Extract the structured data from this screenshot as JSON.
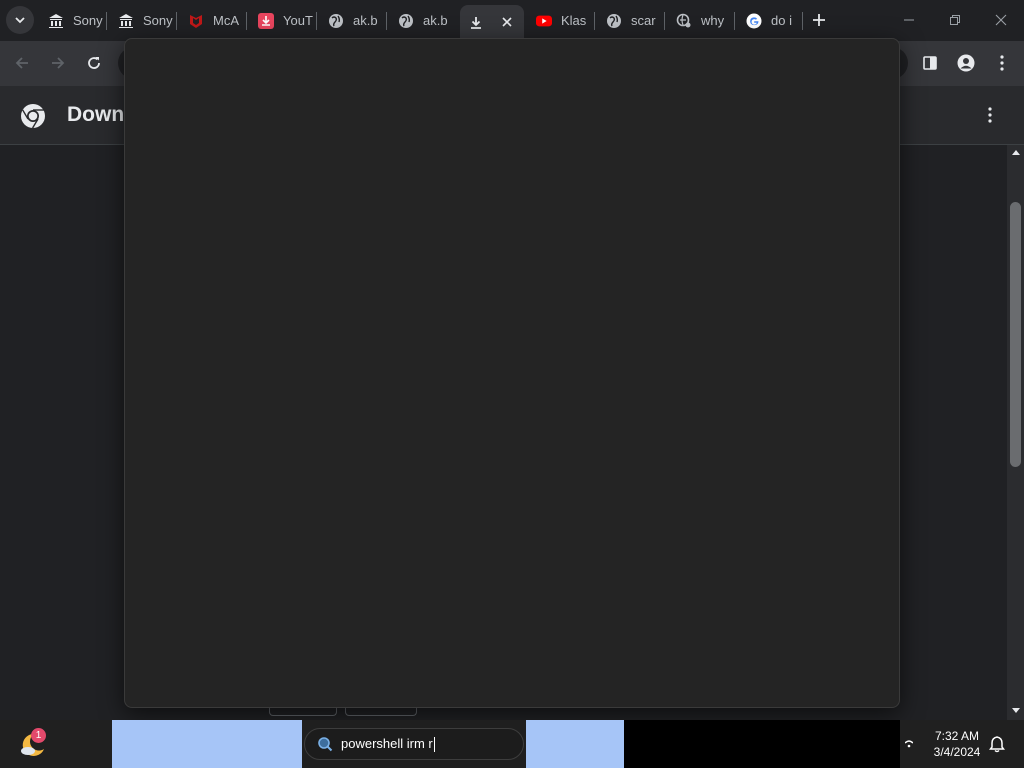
{
  "tabs": [
    {
      "title": "Sony",
      "icon": "bank-icon"
    },
    {
      "title": "Sony",
      "icon": "bank-icon"
    },
    {
      "title": "McA",
      "icon": "mcafee-icon"
    },
    {
      "title": "YouT",
      "icon": "download-icon"
    },
    {
      "title": "ak.b",
      "icon": "globe-icon"
    },
    {
      "title": "ak.b",
      "icon": "globe-icon"
    },
    {
      "title": "",
      "icon": "download-icon",
      "active": true
    },
    {
      "title": "Klas",
      "icon": "youtube-icon"
    },
    {
      "title": "scar",
      "icon": "globe-icon"
    },
    {
      "title": "why",
      "icon": "globe-icon"
    },
    {
      "title": "do i",
      "icon": "google-icon"
    }
  ],
  "page": {
    "title": "Down"
  },
  "taskbar": {
    "badge_count": "1",
    "search_value": "powershell irm r",
    "time": "7:32 AM",
    "date": "3/4/2024"
  },
  "colors": {
    "accent_blue": "#a6c5f7",
    "youtube_red": "#ff0000",
    "mcafee_red": "#c01818",
    "download_pink": "#e8455e"
  }
}
